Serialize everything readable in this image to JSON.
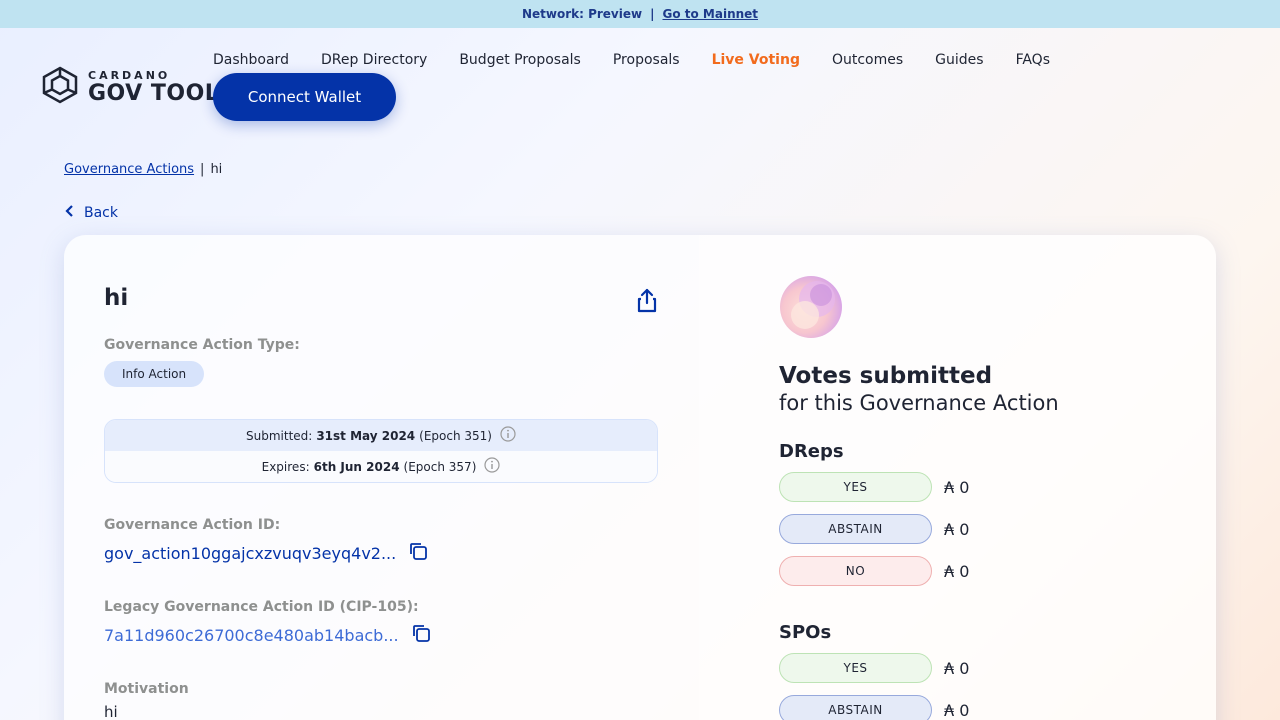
{
  "banner": {
    "network": "Network: Preview",
    "separator": "|",
    "mainnet_link": "Go to Mainnet"
  },
  "logo": {
    "small": "CARDANO",
    "big": "GOV TOOL"
  },
  "nav": {
    "items": [
      "Dashboard",
      "DRep Directory",
      "Budget Proposals",
      "Proposals",
      "Live Voting",
      "Outcomes",
      "Guides",
      "FAQs"
    ],
    "active": "Live Voting"
  },
  "connect_wallet": "Connect Wallet",
  "breadcrumb": {
    "parent": "Governance Actions",
    "separator": "|",
    "current": "hi"
  },
  "back": "Back",
  "action": {
    "title": "hi",
    "type_label": "Governance Action Type:",
    "type_value": "Info Action",
    "submitted_label": "Submitted:",
    "submitted_date": "31st May 2024",
    "submitted_epoch": "(Epoch 351)",
    "expires_label": "Expires:",
    "expires_date": "6th Jun 2024",
    "expires_epoch": "(Epoch 357)",
    "id_label": "Governance Action ID:",
    "id_value": "gov_action10ggajcxzvuqv3eyq4v2...",
    "legacy_label": "Legacy Governance Action ID (CIP-105):",
    "legacy_value": "7a11d960c26700c8e480ab14bacb...",
    "motivation_label": "Motivation",
    "motivation_value": "hi"
  },
  "votes": {
    "title": "Votes submitted",
    "subtitle": "for this Governance Action",
    "dreps_label": "DReps",
    "spos_label": "SPOs",
    "dreps": [
      {
        "label": "YES",
        "amount": "₳ 0"
      },
      {
        "label": "ABSTAIN",
        "amount": "₳ 0"
      },
      {
        "label": "NO",
        "amount": "₳ 0"
      }
    ],
    "spos": [
      {
        "label": "YES",
        "amount": "₳ 0"
      },
      {
        "label": "ABSTAIN",
        "amount": "₳ 0"
      }
    ]
  },
  "colors": {
    "primary": "#0433a8",
    "active_nav": "#f26b1d",
    "banner_bg": "#bfe3f1"
  },
  "icons": [
    "cardano-gov-logo-icon",
    "chevron-left-icon",
    "share-icon",
    "info-icon",
    "copy-icon"
  ]
}
